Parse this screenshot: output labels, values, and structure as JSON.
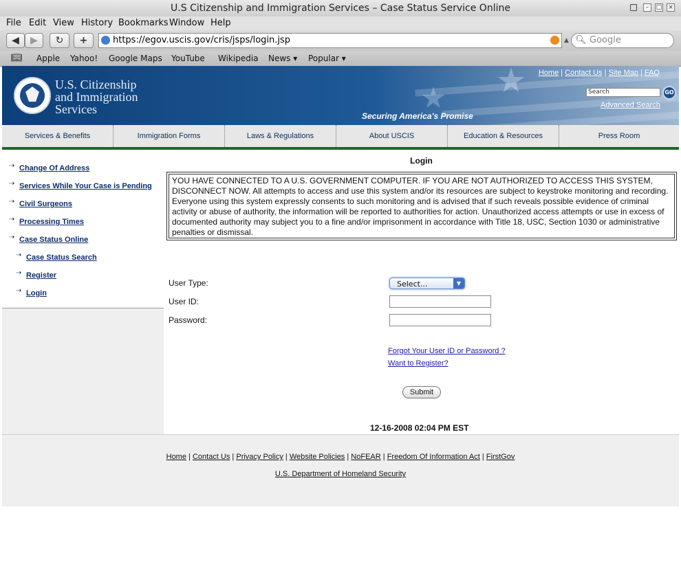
{
  "window": {
    "title": "U.S Citizenship and Immigration Services – Case Status Service Online"
  },
  "menu": [
    "File",
    "Edit",
    "View",
    "History",
    "Bookmarks",
    "Window",
    "Help"
  ],
  "toolbar": {
    "url": "https://egov.uscis.gov/cris/jsps/login.jsp",
    "search_placeholder": "Google"
  },
  "bookmarks": [
    "Apple",
    "Yahoo!",
    "Google Maps",
    "YouTube",
    "Wikipedia",
    "News ▾",
    "Popular ▾"
  ],
  "header": {
    "agency_line1": "U.S. Citizenship",
    "agency_line2": "and Immigration",
    "agency_line3": "Services",
    "tagline": "Securing America's Promise",
    "top_links": [
      "Home",
      "Contact Us",
      "Site Map",
      "FAQ"
    ],
    "search_placeholder": "Search",
    "go_label": "GO",
    "advanced_search": "Advanced Search"
  },
  "nav": [
    "Services & Benefits",
    "Immigration Forms",
    "Laws & Regulations",
    "About USCIS",
    "Education & Resources",
    "Press Room"
  ],
  "sidebar": {
    "items": [
      "Change Of Address",
      "Services While Your Case is Pending",
      "Civil Surgeons",
      "Processing Times",
      "Case Status Online"
    ],
    "subitems": [
      "Case Status Search",
      "Register",
      "Login"
    ]
  },
  "main": {
    "title": "Login",
    "warning": "YOU HAVE CONNECTED TO A U.S. GOVERNMENT COMPUTER. IF YOU ARE NOT AUTHORIZED TO ACCESS THIS SYSTEM, DISCONNECT NOW. All attempts to access and use this system and/or its resources are subject to keystroke monitoring and recording. Everyone using this system expressly consents to such monitoring and is advised that if such reveals possible evidence of criminal activity or abuse of authority, the information will be reported to authorities for action. Unauthorized access attempts or use in excess of documented authority may subject you to a fine and/or imprisonment in accordance with Title 18, USC, Section 1030 or administrative penalties or dismissal.",
    "user_type_label": "User Type:",
    "user_type_value": "Select...",
    "user_id_label": "User ID:",
    "password_label": "Password:",
    "forgot_link": "Forgot Your User ID or Password ?",
    "register_link": "Want to Register?",
    "submit_label": "Submit",
    "timestamp": "12-16-2008 02:04 PM EST"
  },
  "footer": {
    "links": [
      "Home",
      "Contact Us",
      "Privacy Policy",
      "Website Policies",
      "NoFEAR",
      "Freedom Of Information Act",
      "FirstGov"
    ],
    "dhs": "U.S. Department of Homeland Security"
  }
}
